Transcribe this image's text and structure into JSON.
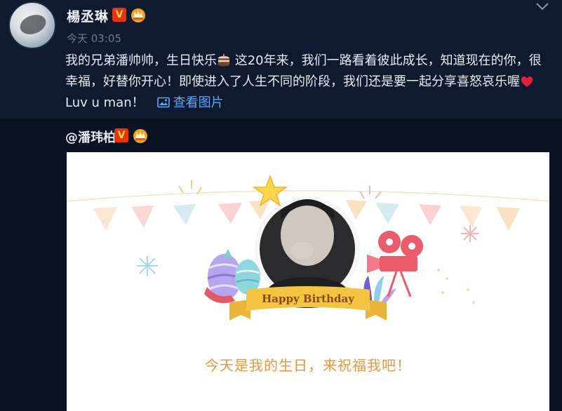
{
  "post": {
    "author": "楊丞琳",
    "timestamp": "今天 03:05",
    "text_part1": "我的兄弟潘帅帅，生日快乐",
    "text_part2": " 这20年来，我们一路看着彼此成长，知道现在的你，很幸福，好替你开心！即使进入了人生不同的阶段，我们还是要一起分享喜怒哀乐喔",
    "text_part3": " Luv u man！",
    "view_image_label": "查看图片"
  },
  "repost": {
    "mention": "@潘玮柏",
    "banner_text": "Happy Birthday",
    "caption": "今天是我的生日，来祝福我吧！"
  },
  "badges": {
    "verified": "V"
  },
  "colors": {
    "background": "#0d1628",
    "link": "#5fa8ff",
    "verified": "#e8330e",
    "caption": "#f0953a",
    "ribbon": "#f5c542",
    "heart": "#e0203a"
  },
  "icons": [
    "chevron-down-icon",
    "crown-icon",
    "cake-emoji-icon",
    "heart-emoji-icon",
    "image-icon",
    "star-icon",
    "camera-icon"
  ]
}
